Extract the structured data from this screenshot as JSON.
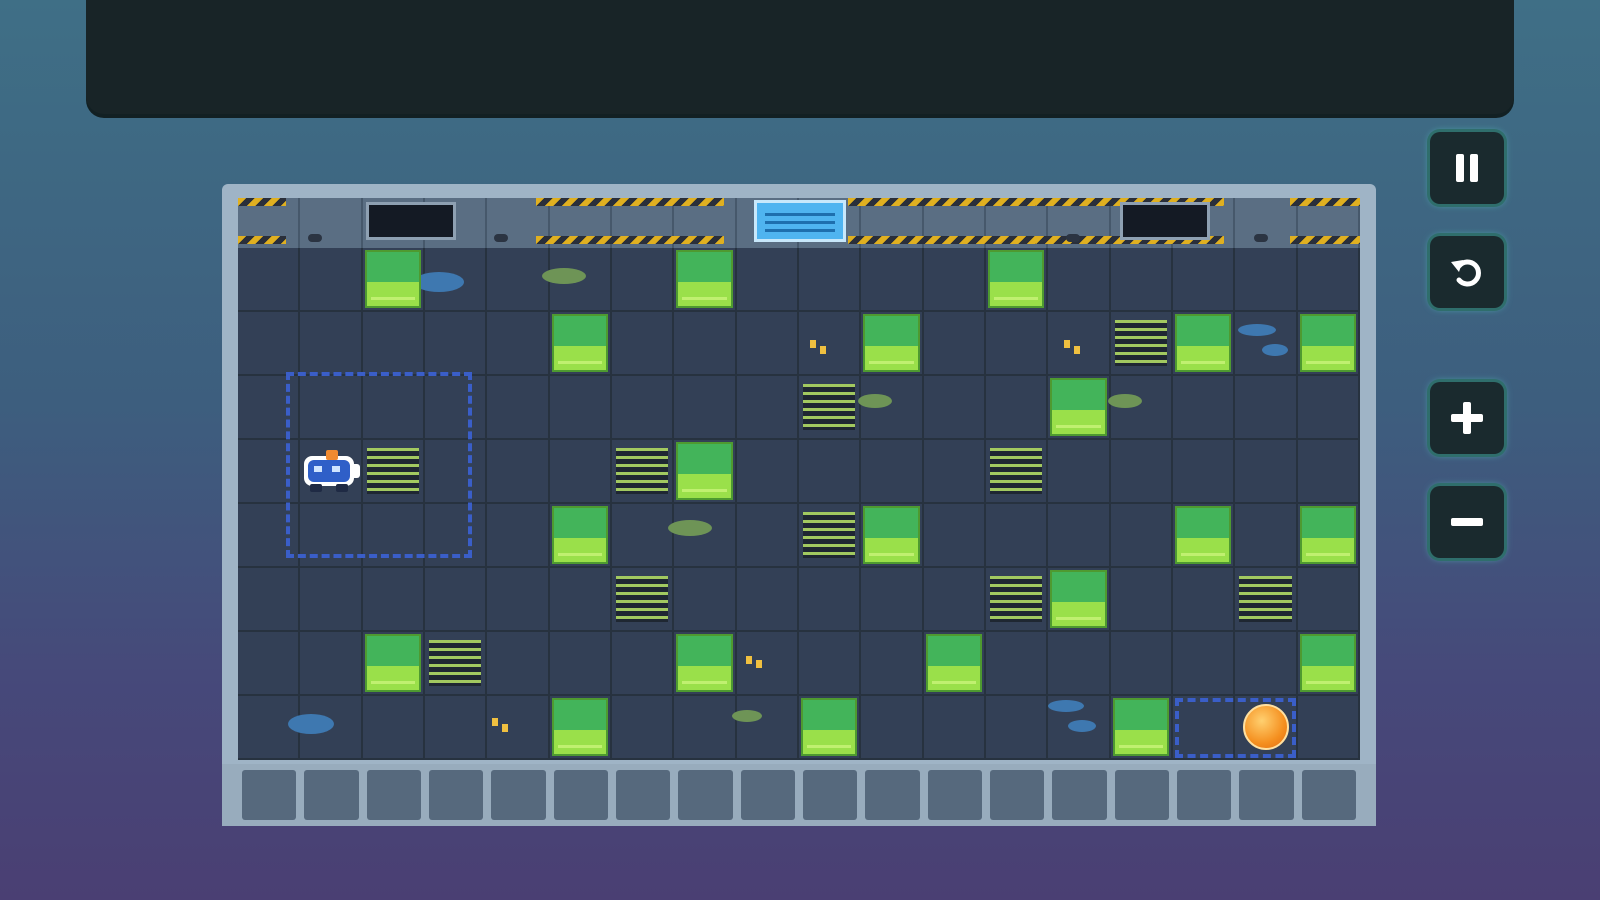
{
  "controls": {
    "pause": {
      "icon": "pause-icon"
    },
    "restart": {
      "icon": "restart-icon"
    },
    "zoom_in": {
      "icon": "plus-icon"
    },
    "zoom_out": {
      "icon": "minus-icon"
    }
  },
  "board": {
    "columns": 18,
    "rows": 8,
    "player": {
      "icon": "robot-icon",
      "col": 1,
      "row": 3
    },
    "goal": {
      "icon": "orange-orb-icon",
      "col": 16,
      "row": 7
    },
    "blocks": [
      [
        2,
        0
      ],
      [
        7,
        0
      ],
      [
        12,
        0
      ],
      [
        5,
        1
      ],
      [
        10,
        1
      ],
      [
        15,
        1
      ],
      [
        17,
        1
      ],
      [
        13,
        2
      ],
      [
        7,
        3
      ],
      [
        5,
        4
      ],
      [
        10,
        4
      ],
      [
        15,
        4
      ],
      [
        17,
        4
      ],
      [
        13,
        5
      ],
      [
        2,
        6
      ],
      [
        7,
        6
      ],
      [
        11,
        6
      ],
      [
        17,
        6
      ],
      [
        5,
        7
      ],
      [
        9,
        7
      ],
      [
        14,
        7
      ]
    ],
    "grates": [
      [
        14,
        1
      ],
      [
        9,
        2
      ],
      [
        2,
        3
      ],
      [
        6,
        3
      ],
      [
        12,
        3
      ],
      [
        9,
        4
      ],
      [
        6,
        5
      ],
      [
        12,
        5
      ],
      [
        16,
        5
      ],
      [
        3,
        6
      ]
    ],
    "colors": {
      "block_top": "#43b45a",
      "block_bottom": "#9ae04a",
      "floor": "#334056",
      "zone": "#3a5ec8",
      "hazard": "#e0b020"
    }
  }
}
